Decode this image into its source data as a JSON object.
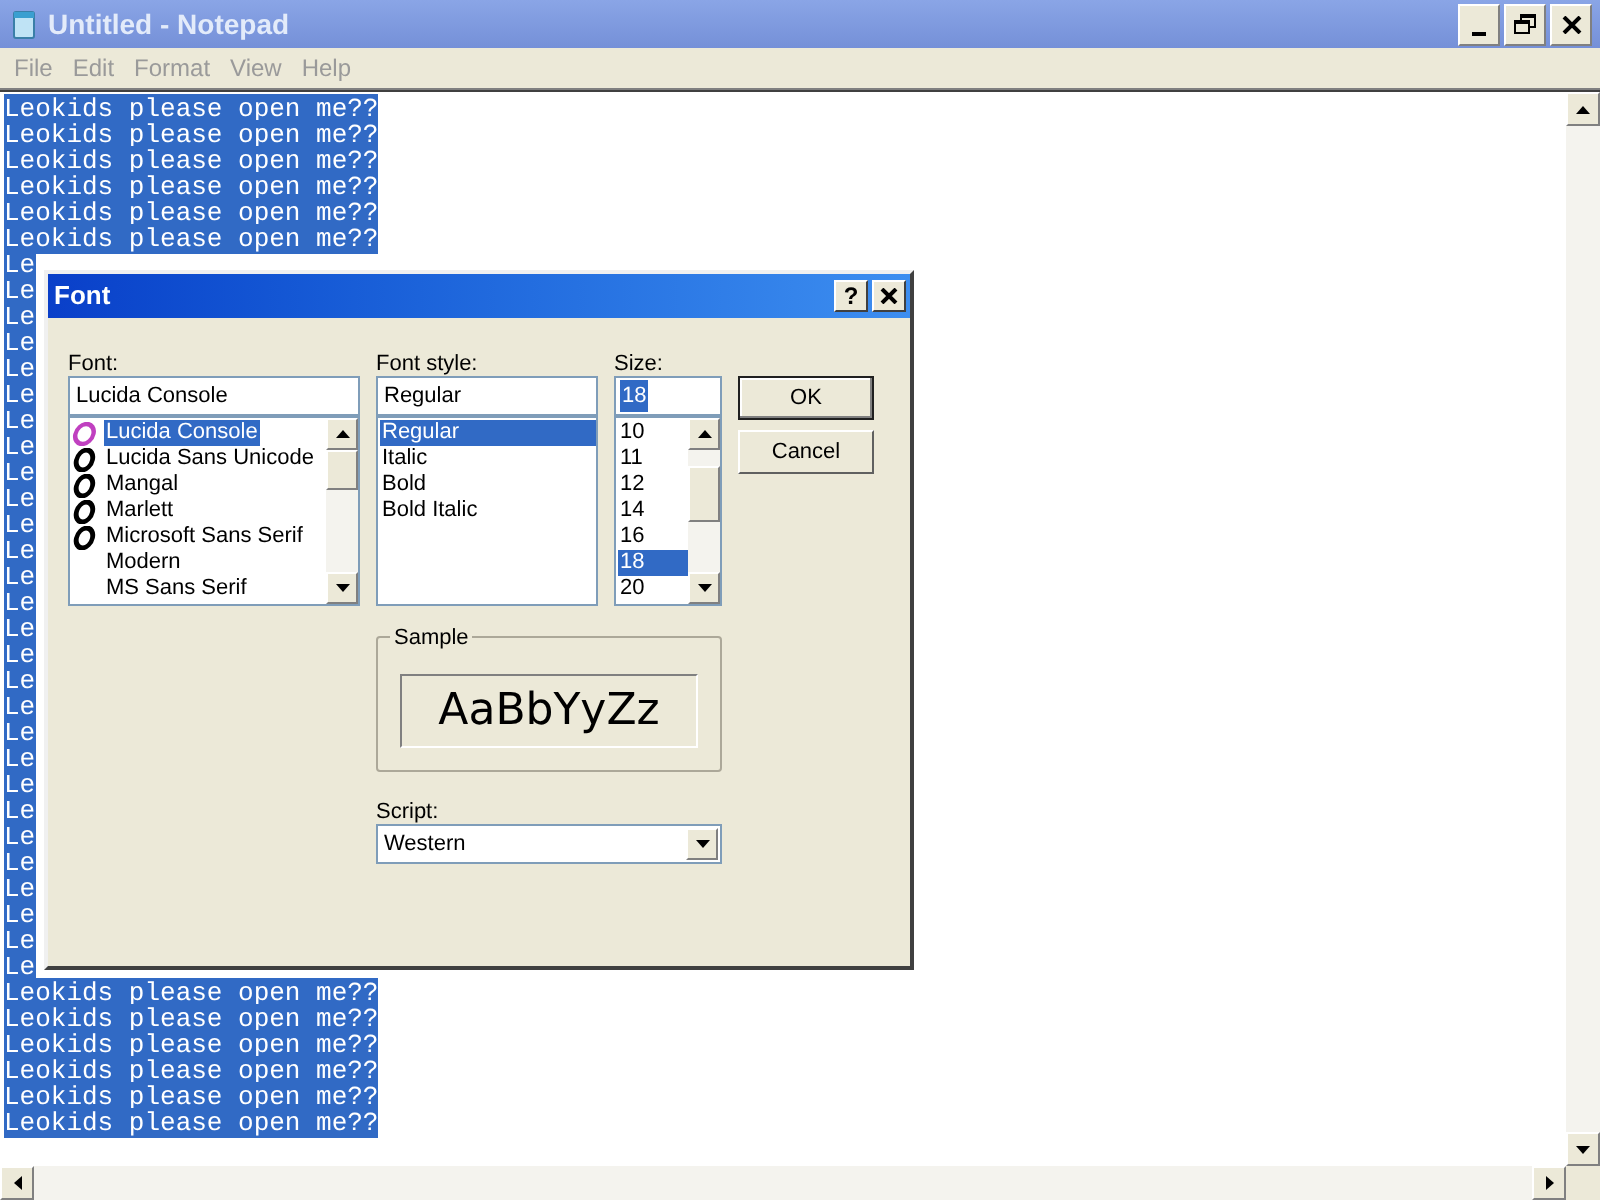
{
  "window": {
    "title": "Untitled - Notepad"
  },
  "menu": [
    "File",
    "Edit",
    "Format",
    "View",
    "Help"
  ],
  "document": {
    "lines": [
      {
        "text": "Leokids please open me??",
        "selected": true
      },
      {
        "text": "Leokids please open me??",
        "selected": true
      },
      {
        "text": "Leokids please open me??",
        "selected": true
      },
      {
        "text": "Leokids please open me??",
        "selected": true
      },
      {
        "text": "Leokids please open me??",
        "selected": true
      },
      {
        "text": "Leokids please open me??",
        "selected": true
      },
      {
        "text": "Le",
        "selected": true
      },
      {
        "text": "Le",
        "selected": true
      },
      {
        "text": "Le",
        "selected": true
      },
      {
        "text": "Le",
        "selected": true
      },
      {
        "text": "Le",
        "selected": true
      },
      {
        "text": "Le",
        "selected": true
      },
      {
        "text": "Le",
        "selected": true
      },
      {
        "text": "Le",
        "selected": true
      },
      {
        "text": "Le",
        "selected": true
      },
      {
        "text": "Le",
        "selected": true
      },
      {
        "text": "Le",
        "selected": true
      },
      {
        "text": "Le",
        "selected": true
      },
      {
        "text": "Le",
        "selected": true
      },
      {
        "text": "Le",
        "selected": true
      },
      {
        "text": "Le",
        "selected": true
      },
      {
        "text": "Le",
        "selected": true
      },
      {
        "text": "Le",
        "selected": true
      },
      {
        "text": "Le",
        "selected": true
      },
      {
        "text": "Le",
        "selected": true
      },
      {
        "text": "Le",
        "selected": true
      },
      {
        "text": "Le",
        "selected": true
      },
      {
        "text": "Le",
        "selected": true
      },
      {
        "text": "Le",
        "selected": true
      },
      {
        "text": "Le",
        "selected": true
      },
      {
        "text": "Le",
        "selected": true
      },
      {
        "text": "Le",
        "selected": true
      },
      {
        "text": "Le",
        "selected": true
      },
      {
        "text": "Le",
        "selected": true
      },
      {
        "text": "Leokids please open me??",
        "selected": true
      },
      {
        "text": "Leokids please open me??",
        "selected": true
      },
      {
        "text": "Leokids please open me??",
        "selected": true
      },
      {
        "text": "Leokids please open me??",
        "selected": true
      },
      {
        "text": "Leokids please open me??",
        "selected": true
      },
      {
        "text": "Leokids please open me??",
        "selected": true
      }
    ]
  },
  "dialog": {
    "title": "Font",
    "help_glyph": "?",
    "font": {
      "label": "Font:",
      "value": "Lucida Console",
      "items": [
        {
          "name": "Lucida Console",
          "kind": "truetype",
          "selected": true
        },
        {
          "name": "Lucida Sans Unicode",
          "kind": "opentype",
          "selected": false
        },
        {
          "name": "Mangal",
          "kind": "opentype",
          "selected": false
        },
        {
          "name": "Marlett",
          "kind": "opentype",
          "selected": false
        },
        {
          "name": "Microsoft Sans Serif",
          "kind": "opentype",
          "selected": false
        },
        {
          "name": "Modern",
          "kind": "plain",
          "selected": false
        },
        {
          "name": "MS Sans Serif",
          "kind": "plain",
          "selected": false
        }
      ]
    },
    "style": {
      "label": "Font style:",
      "value": "Regular",
      "items": [
        {
          "name": "Regular",
          "selected": true
        },
        {
          "name": "Italic",
          "selected": false
        },
        {
          "name": "Bold",
          "selected": false
        },
        {
          "name": "Bold Italic",
          "selected": false
        }
      ]
    },
    "size": {
      "label": "Size:",
      "value": "18",
      "value_selected": true,
      "items": [
        {
          "name": "10",
          "selected": false
        },
        {
          "name": "11",
          "selected": false
        },
        {
          "name": "12",
          "selected": false
        },
        {
          "name": "14",
          "selected": false
        },
        {
          "name": "16",
          "selected": false
        },
        {
          "name": "18",
          "selected": true
        },
        {
          "name": "20",
          "selected": false
        }
      ]
    },
    "buttons": [
      {
        "label": "OK",
        "default": true
      },
      {
        "label": "Cancel",
        "default": false
      }
    ],
    "sample": {
      "label": "Sample",
      "text": "AaBbYyZz"
    },
    "script": {
      "label": "Script:",
      "value": "Western"
    }
  }
}
